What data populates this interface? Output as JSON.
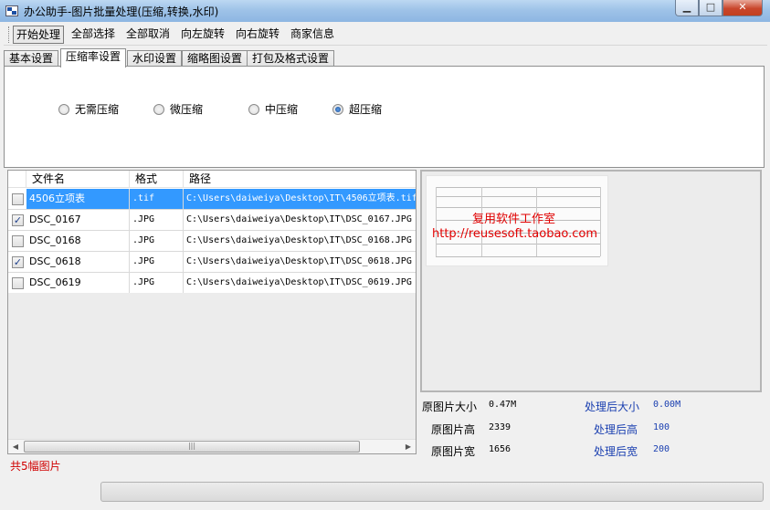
{
  "window": {
    "title": "办公助手-图片批量处理(压缩,转换,水印)",
    "controls": {
      "minimize": "▁",
      "maximize": "□",
      "close": "✕"
    }
  },
  "toolbar": {
    "items": [
      "开始处理",
      "全部选择",
      "全部取消",
      "向左旋转",
      "向右旋转",
      "商家信息"
    ]
  },
  "tabs": [
    "基本设置",
    "压缩率设置",
    "水印设置",
    "缩略图设置",
    "打包及格式设置"
  ],
  "selected_tab": "压缩率设置",
  "compression": {
    "options": [
      "无需压缩",
      "微压缩",
      "中压缩",
      "超压缩"
    ],
    "selected": "超压缩"
  },
  "filelist": {
    "columns": [
      "文件名",
      "格式",
      "路径"
    ],
    "rows": [
      {
        "checked": false,
        "selected": true,
        "name": "4506立项表",
        "format": ".tif",
        "path": "C:\\Users\\daiweiya\\Desktop\\IT\\4506立项表.tif"
      },
      {
        "checked": true,
        "selected": false,
        "name": "DSC_0167",
        "format": ".JPG",
        "path": "C:\\Users\\daiweiya\\Desktop\\IT\\DSC_0167.JPG"
      },
      {
        "checked": false,
        "selected": false,
        "name": "DSC_0168",
        "format": ".JPG",
        "path": "C:\\Users\\daiweiya\\Desktop\\IT\\DSC_0168.JPG"
      },
      {
        "checked": true,
        "selected": false,
        "name": "DSC_0618",
        "format": ".JPG",
        "path": "C:\\Users\\daiweiya\\Desktop\\IT\\DSC_0618.JPG"
      },
      {
        "checked": false,
        "selected": false,
        "name": "DSC_0619",
        "format": ".JPG",
        "path": "C:\\Users\\daiweiya\\Desktop\\IT\\DSC_0619.JPG"
      }
    ],
    "count_text": "共5幅图片"
  },
  "preview": {
    "watermark_line1": "复用软件工作室",
    "watermark_line2": "http://reusesoft.taobao.com"
  },
  "info": {
    "orig_size_label": "原图片大小",
    "orig_size_value": "0.47M",
    "orig_height_label": "原图片高",
    "orig_height_value": "2339",
    "orig_width_label": "原图片宽",
    "orig_width_value": "1656",
    "new_size_label": "处理后大小",
    "new_size_value": "0.00M",
    "new_height_label": "处理后高",
    "new_height_value": "100",
    "new_width_label": "处理后宽",
    "new_width_value": "200"
  },
  "progress": {
    "value": 0
  },
  "colors": {
    "selection": "#3399ff",
    "accent_blue": "#1a3fb0",
    "count_red": "#d00000"
  }
}
